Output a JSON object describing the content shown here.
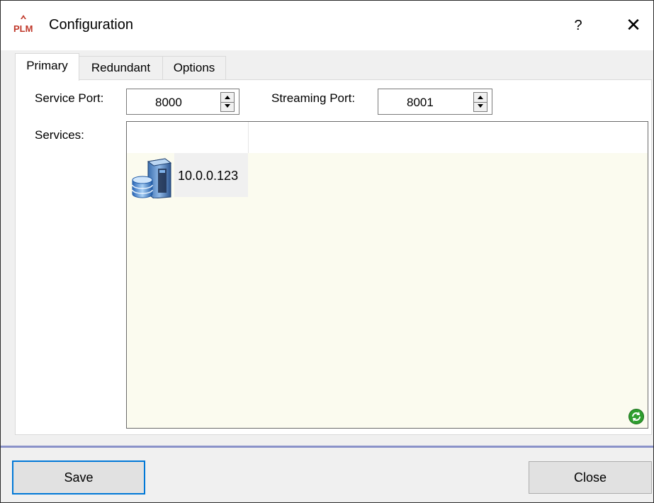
{
  "window": {
    "title": "Configuration",
    "help_label": "?",
    "close_glyph": "✕",
    "app_icon": "app-logo-icon",
    "app_icon_text": "PLM"
  },
  "tabs": [
    {
      "label": "Primary",
      "active": true
    },
    {
      "label": "Redundant",
      "active": false
    },
    {
      "label": "Options",
      "active": false
    }
  ],
  "primary": {
    "service_port_label": "Service Port:",
    "service_port_value": "8000",
    "streaming_port_label": "Streaming Port:",
    "streaming_port_value": "8001",
    "services_label": "Services:",
    "services": [
      {
        "name": "10.0.0.123",
        "icon": "server-database-icon"
      }
    ],
    "refresh_icon": "refresh-icon"
  },
  "footer": {
    "save_label": "Save",
    "close_label": "Close"
  },
  "colors": {
    "accent": "#0078d7",
    "services_background": "#fbfbef",
    "separator": "#8a92c9"
  }
}
